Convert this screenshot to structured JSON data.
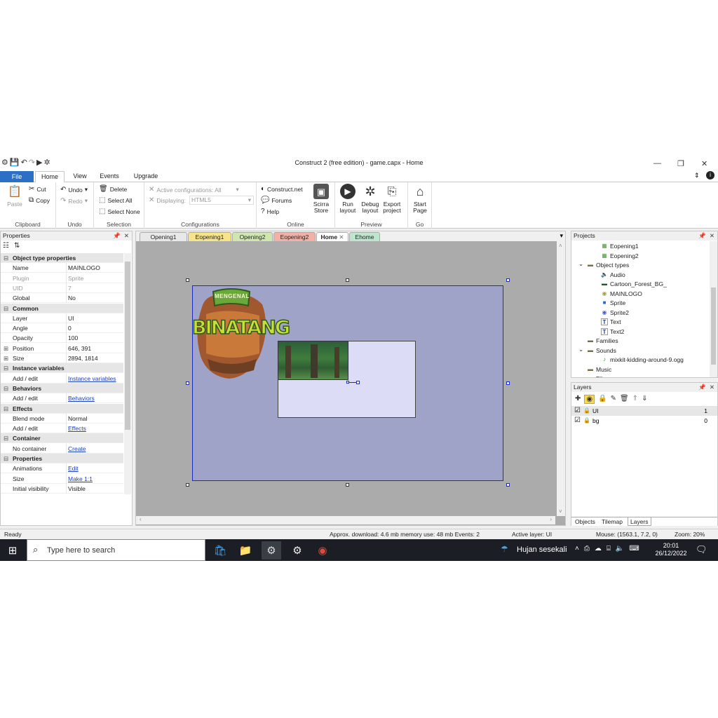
{
  "window": {
    "title": "Construct 2  (free edition) - game.capx - Home",
    "minimize": "—",
    "restore": "❐",
    "close": "✕"
  },
  "ribbon_tabs": [
    "File",
    "Home",
    "View",
    "Events",
    "Upgrade"
  ],
  "ribbon": {
    "clipboard": {
      "paste": "Paste",
      "cut": "Cut",
      "copy": "Copy",
      "label": "Clipboard"
    },
    "undo": {
      "undo": "Undo",
      "redo": "Redo",
      "label": "Undo"
    },
    "selection": {
      "delete": "Delete",
      "select_all": "Select All",
      "select_none": "Select None",
      "label": "Selection"
    },
    "configurations": {
      "active_label": "Active configurations: All",
      "displaying_label": "Displaying:",
      "displaying_value": "HTML5",
      "label": "Configurations"
    },
    "online": {
      "construct_net": "Construct.net",
      "forums": "Forums",
      "help": "Help",
      "label": "Online"
    },
    "store": {
      "line1": "Scirra",
      "line2": "Store"
    },
    "preview": {
      "run_1": "Run",
      "run_2": "layout",
      "debug_1": "Debug",
      "debug_2": "layout",
      "export_1": "Export",
      "export_2": "project",
      "label": "Preview"
    },
    "go": {
      "start_1": "Start",
      "start_2": "Page",
      "label": "Go"
    }
  },
  "properties": {
    "title": "Properties",
    "rows": [
      {
        "type": "cat",
        "k": "Object type properties"
      },
      {
        "k": "Name",
        "v": "MAINLOGO"
      },
      {
        "k": "Plugin",
        "v": "Sprite",
        "gray": true
      },
      {
        "k": "UID",
        "v": "7",
        "gray": true
      },
      {
        "k": "Global",
        "v": "No"
      },
      {
        "type": "cat",
        "k": "Common"
      },
      {
        "k": "Layer",
        "v": "UI"
      },
      {
        "k": "Angle",
        "v": "0"
      },
      {
        "k": "Opacity",
        "v": "100"
      },
      {
        "k": "Position",
        "v": "646, 391",
        "plus": true
      },
      {
        "k": "Size",
        "v": "2894, 1814",
        "plus": true
      },
      {
        "type": "cat",
        "k": "Instance variables"
      },
      {
        "k": "Add / edit",
        "v": "Instance variables",
        "link": true
      },
      {
        "type": "cat",
        "k": "Behaviors"
      },
      {
        "k": "Add / edit",
        "v": "Behaviors",
        "link": true
      },
      {
        "type": "cat",
        "k": "Effects"
      },
      {
        "k": "Blend mode",
        "v": "Normal"
      },
      {
        "k": "Add / edit",
        "v": "Effects",
        "link": true
      },
      {
        "type": "cat",
        "k": "Container"
      },
      {
        "k": "No container",
        "v": "Create",
        "link": true
      },
      {
        "type": "cat",
        "k": "Properties"
      },
      {
        "k": "Animations",
        "v": "Edit",
        "link": true
      },
      {
        "k": "Size",
        "v": "Make 1:1",
        "link": true
      },
      {
        "k": "Initial visibility",
        "v": "Visible"
      }
    ]
  },
  "doc_tabs": [
    {
      "label": "Opening1",
      "color": "#e8e8e8"
    },
    {
      "label": "Eopening1",
      "color": "#f6e38a"
    },
    {
      "label": "Opening2",
      "color": "#cfe6b0"
    },
    {
      "label": "Eopening2",
      "color": "#f2b0a6"
    },
    {
      "label": "Home",
      "color": "#ffffff",
      "active": true
    },
    {
      "label": "Ehome",
      "color": "#bfe5cf"
    }
  ],
  "layout": {
    "logo_top": "MENGENAL",
    "logo_main": "BINATANG"
  },
  "projects": {
    "title": "Projects",
    "items": [
      {
        "label": "Eopening1",
        "icon": "sheet",
        "indent": 3
      },
      {
        "label": "Eopening2",
        "icon": "sheet",
        "indent": 3
      },
      {
        "label": "Object types",
        "icon": "folder",
        "indent": 1,
        "arrow": "v"
      },
      {
        "label": "Audio",
        "icon": "audio",
        "indent": 3
      },
      {
        "label": "Cartoon_Forest_BG_",
        "icon": "tiled",
        "indent": 3
      },
      {
        "label": "MAINLOGO",
        "icon": "sprite",
        "indent": 3
      },
      {
        "label": "Sprite",
        "icon": "blue",
        "indent": 3
      },
      {
        "label": "Sprite2",
        "icon": "round",
        "indent": 3
      },
      {
        "label": "Text",
        "icon": "text",
        "indent": 3
      },
      {
        "label": "Text2",
        "icon": "text",
        "indent": 3
      },
      {
        "label": "Families",
        "icon": "folder",
        "indent": 1
      },
      {
        "label": "Sounds",
        "icon": "folder",
        "indent": 1,
        "arrow": "v"
      },
      {
        "label": "mixkit-kidding-around-9.ogg",
        "icon": "sound",
        "indent": 3
      },
      {
        "label": "Music",
        "icon": "folder",
        "indent": 1
      },
      {
        "label": "Files",
        "icon": "folder",
        "indent": 1,
        "arrow": "v"
      }
    ]
  },
  "layers": {
    "title": "Layers",
    "rows": [
      {
        "name": "UI",
        "index": "1"
      },
      {
        "name": "bg",
        "index": "0"
      }
    ],
    "bottom_tabs": [
      "Objects",
      "Tilemap",
      "Layers"
    ]
  },
  "status": {
    "ready": "Ready",
    "download": "Approx. download: 4.6 mb  memory use: 48 mb  Events: 2",
    "active_layer": "Active layer: UI",
    "mouse": "Mouse: (1563.1, 7.2, 0)",
    "zoom": "Zoom: 20%"
  },
  "taskbar": {
    "search_placeholder": "Type here to search",
    "weather": "Hujan sesekali",
    "time": "20:01",
    "date": "26/12/2022"
  }
}
